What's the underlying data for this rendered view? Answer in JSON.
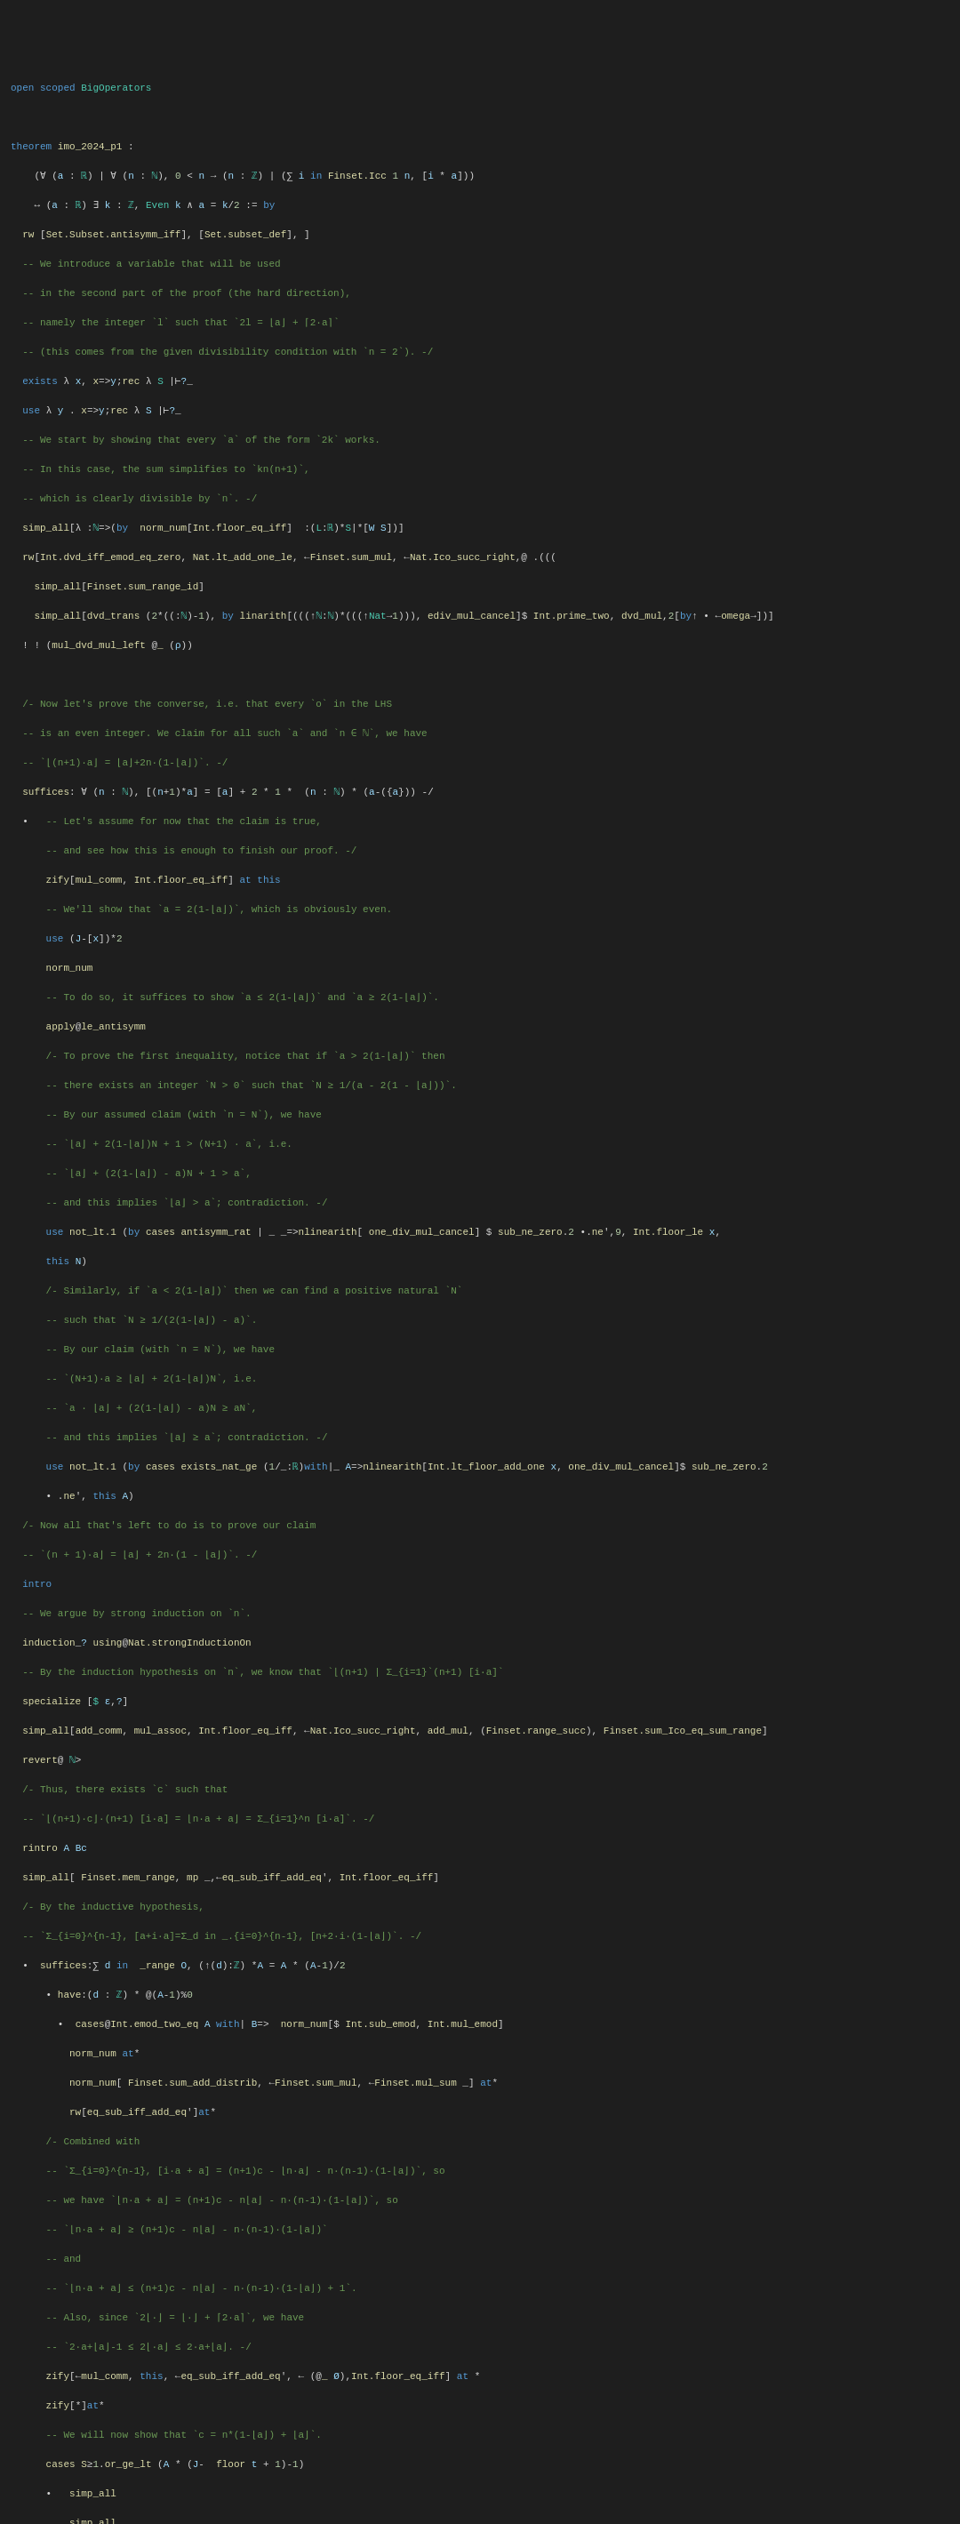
{
  "title": "open scoped BigOperators",
  "content": "code"
}
